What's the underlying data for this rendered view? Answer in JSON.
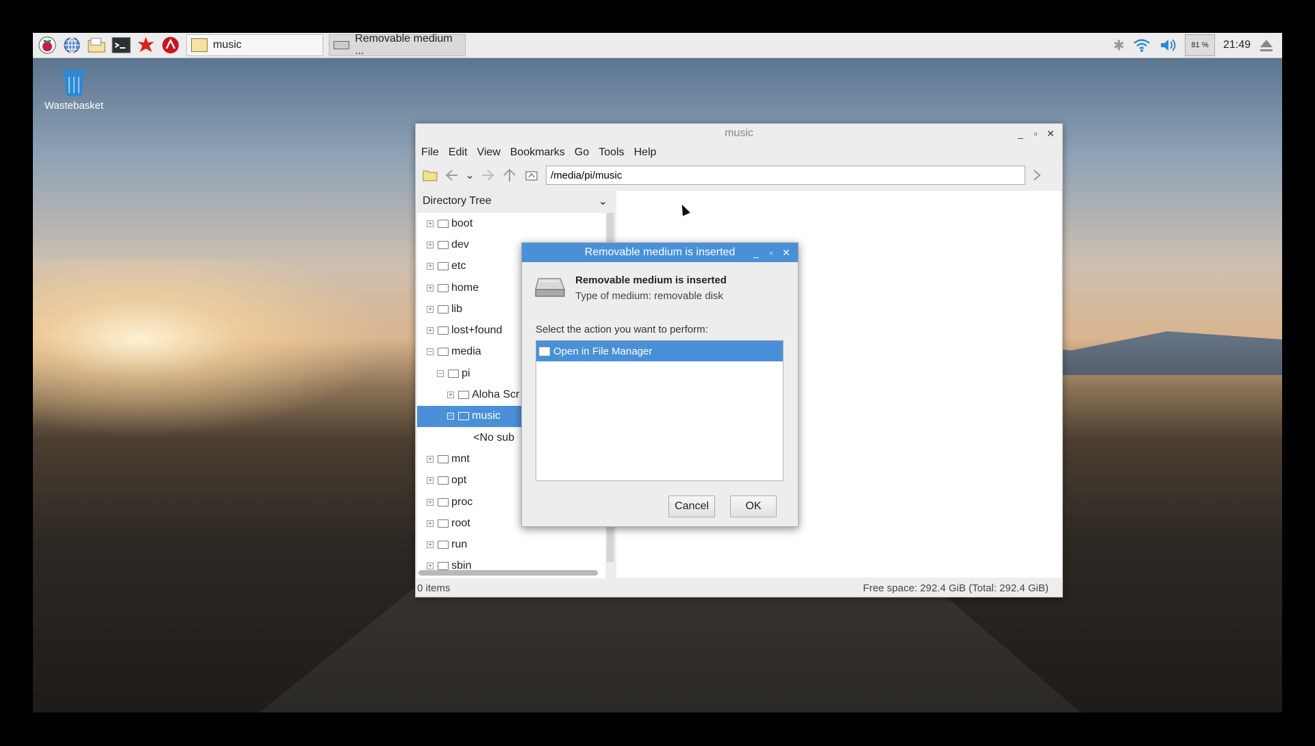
{
  "taskbar": {
    "launchers": [
      "raspberry-menu-icon",
      "web-browser-icon",
      "file-manager-icon",
      "terminal-icon",
      "mathematica-icon",
      "wolfram-icon"
    ],
    "tasks": [
      {
        "label": "music",
        "active": false
      },
      {
        "label": "Removable medium ...",
        "active": true
      }
    ],
    "tray": {
      "cpu": "81 %",
      "clock": "21:49"
    }
  },
  "desktop": {
    "wastebasket_label": "Wastebasket"
  },
  "file_manager": {
    "title": "music",
    "menu": [
      "File",
      "Edit",
      "View",
      "Bookmarks",
      "Go",
      "Tools",
      "Help"
    ],
    "address": "/media/pi/music",
    "tree_header": "Directory Tree",
    "tree": [
      {
        "label": "boot",
        "expander": "+",
        "level": 0
      },
      {
        "label": "dev",
        "expander": "+",
        "level": 0
      },
      {
        "label": "etc",
        "expander": "+",
        "level": 0
      },
      {
        "label": "home",
        "expander": "+",
        "level": 0
      },
      {
        "label": "lib",
        "expander": "+",
        "level": 0
      },
      {
        "label": "lost+found",
        "expander": "+",
        "level": 0
      },
      {
        "label": "media",
        "expander": "−",
        "level": 0
      },
      {
        "label": "pi",
        "expander": "−",
        "level": 1
      },
      {
        "label": "Aloha Scr",
        "expander": "+",
        "level": 2
      },
      {
        "label": "music",
        "expander": "−",
        "level": 2,
        "selected": true
      },
      {
        "label": "<No sub",
        "expander": "",
        "level": 3
      },
      {
        "label": "mnt",
        "expander": "+",
        "level": 0
      },
      {
        "label": "opt",
        "expander": "+",
        "level": 0
      },
      {
        "label": "proc",
        "expander": "+",
        "level": 0
      },
      {
        "label": "root",
        "expander": "+",
        "level": 0
      },
      {
        "label": "run",
        "expander": "+",
        "level": 0
      },
      {
        "label": "sbin",
        "expander": "+",
        "level": 0
      }
    ],
    "status_left": "0 items",
    "status_right": "Free space: 292.4 GiB (Total: 292.4 GiB)"
  },
  "dialog": {
    "title": "Removable medium is inserted",
    "heading": "Removable medium is inserted",
    "type_line": "Type of medium:   removable disk",
    "prompt": "Select the action you want to perform:",
    "actions": [
      "Open in File Manager"
    ],
    "cancel_label": "Cancel",
    "ok_label": "OK"
  },
  "colors": {
    "accent": "#4a90d9",
    "taskbar": "#ececec"
  }
}
